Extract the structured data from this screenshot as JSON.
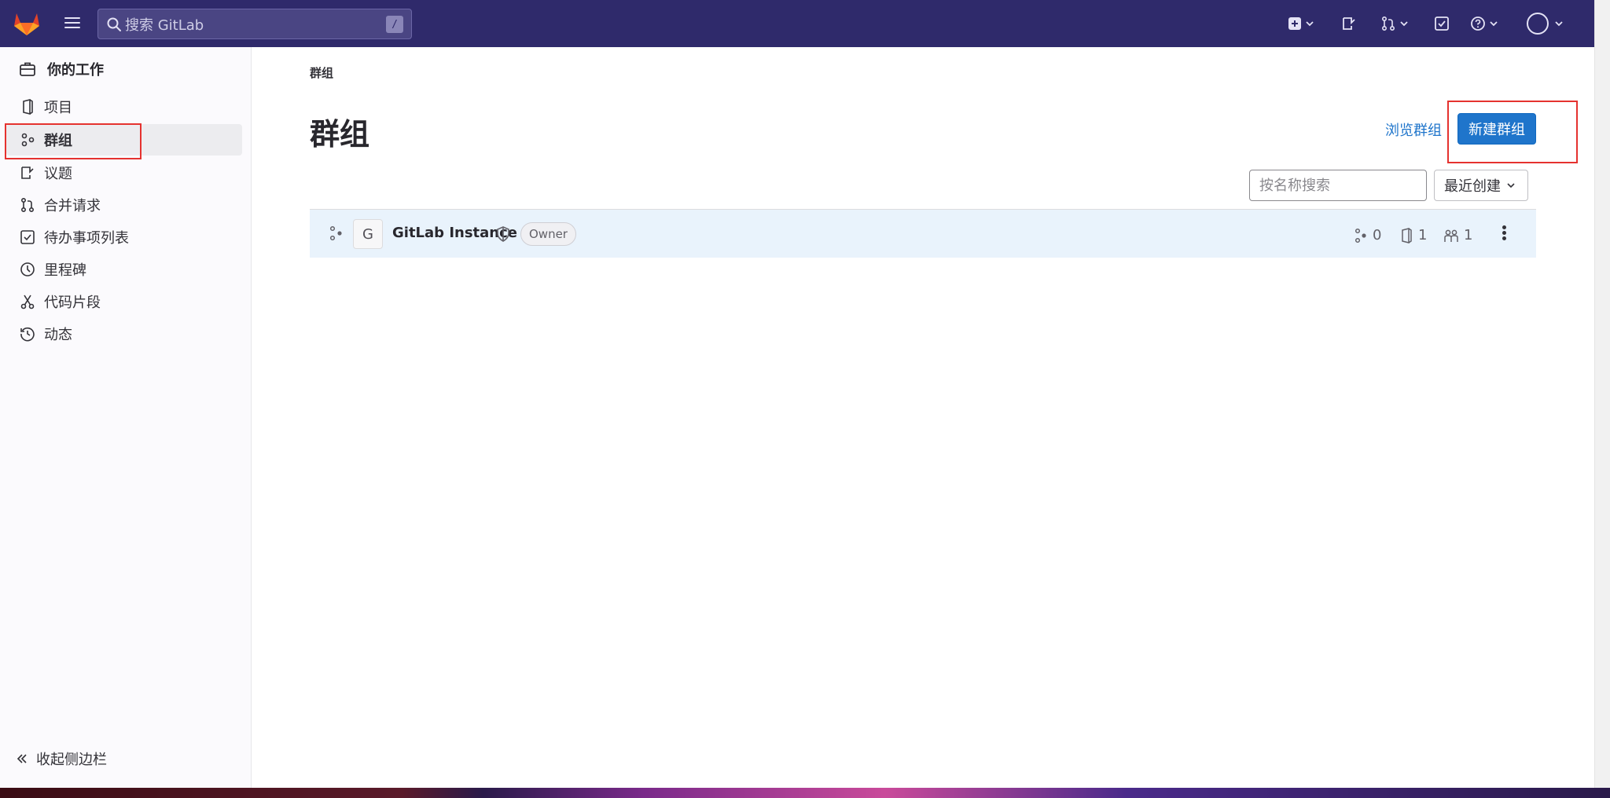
{
  "topbar": {
    "search_placeholder": "搜索 GitLab",
    "search_shortcut": "/"
  },
  "sidebar": {
    "header": "你的工作",
    "items": [
      {
        "label": "项目",
        "icon": "project-icon",
        "active": false
      },
      {
        "label": "群组",
        "icon": "group-icon",
        "active": true
      },
      {
        "label": "议题",
        "icon": "issues-icon",
        "active": false
      },
      {
        "label": "合并请求",
        "icon": "merge-request-icon",
        "active": false
      },
      {
        "label": "待办事项列表",
        "icon": "todo-icon",
        "active": false
      },
      {
        "label": "里程碑",
        "icon": "clock-icon",
        "active": false
      },
      {
        "label": "代码片段",
        "icon": "snippet-icon",
        "active": false
      },
      {
        "label": "动态",
        "icon": "history-icon",
        "active": false
      }
    ],
    "collapse_label": "收起侧边栏"
  },
  "main": {
    "breadcrumb": "群组",
    "title": "群组",
    "browse_link": "浏览群组",
    "new_button": "新建群组",
    "filter_placeholder": "按名称搜索",
    "sort_label": "最近创建",
    "groups": [
      {
        "avatar_letter": "G",
        "name": "GitLab Instance",
        "role": "Owner",
        "subgroups": "0",
        "projects": "1",
        "members": "1"
      }
    ]
  },
  "colors": {
    "topbar": "#2f2a6b",
    "primary": "#1f75cb",
    "highlight": "#e5322f",
    "row_bg": "#e9f3fc"
  }
}
